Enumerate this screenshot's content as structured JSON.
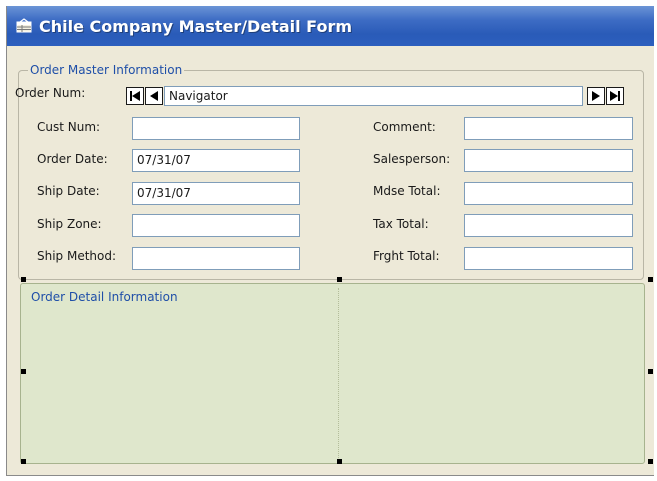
{
  "window": {
    "title": "Chile Company Master/Detail Form",
    "title_icon": "form-grid-icon"
  },
  "master": {
    "group_label": "Order Master Information",
    "order_num_label": "Order Num:",
    "navigator": {
      "text": "Navigator",
      "first_icon": "first-record-icon",
      "prev_icon": "prev-record-icon",
      "next_icon": "next-record-icon",
      "last_icon": "last-record-icon"
    },
    "left_fields": [
      {
        "label": "Cust Num:",
        "value": ""
      },
      {
        "label": "Order Date:",
        "value": "07/31/07"
      },
      {
        "label": "Ship Date:",
        "value": "07/31/07"
      },
      {
        "label": "Ship Zone:",
        "value": ""
      },
      {
        "label": "Ship Method:",
        "value": ""
      }
    ],
    "right_fields": [
      {
        "label": "Comment:",
        "value": ""
      },
      {
        "label": "Salesperson:",
        "value": ""
      },
      {
        "label": "Mdse Total:",
        "value": ""
      },
      {
        "label": "Tax Total:",
        "value": ""
      },
      {
        "label": "Frght Total:",
        "value": ""
      }
    ]
  },
  "detail": {
    "group_label": "Order Detail Information"
  },
  "colors": {
    "title_bar": "#2a5bb8",
    "form_bg": "#ede9d8",
    "detail_bg": "#dfe7cc",
    "group_label": "#1f4fa8"
  }
}
